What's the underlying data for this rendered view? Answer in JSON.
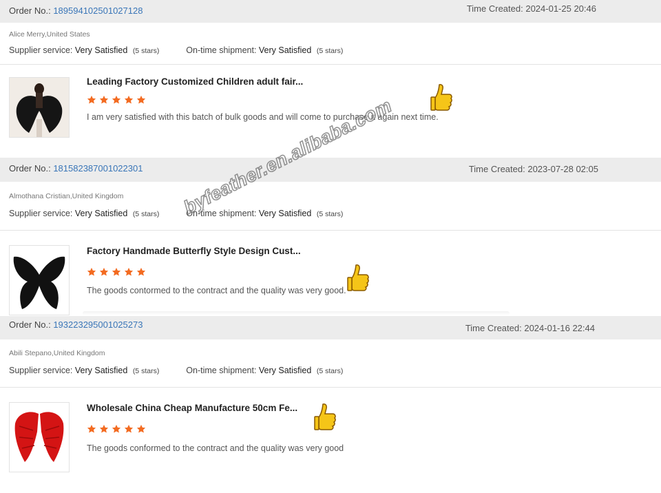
{
  "labels": {
    "order_no": "Order No.:",
    "time_created": "Time Created:",
    "supplier_service": "Supplier service:",
    "ontime_shipment": "On-time shipment:"
  },
  "reviews": [
    {
      "order_no": "189594102501027128",
      "time_created": "2024-01-25 20:46",
      "buyer": "Alice Merry,United States",
      "supplier_rating": "Very Satisfied",
      "supplier_stars": "(5 stars)",
      "shipment_rating": "Very Satisfied",
      "shipment_stars": "(5 stars)",
      "product_title": "Leading Factory Customized Children adult fair...",
      "rating": 5,
      "comment": "I am very satisfied with this batch of bulk goods and will come to purchase it again next time.",
      "thumb_icon": "black-feather-wings-on-person-photo"
    },
    {
      "order_no": "181582387001022301",
      "time_created": "2023-07-28 02:05",
      "buyer": "Almothana Cristian,United Kingdom",
      "supplier_rating": "Very Satisfied",
      "supplier_stars": "(5 stars)",
      "shipment_rating": "Very Satisfied",
      "shipment_stars": "(5 stars)",
      "product_title": "Factory Handmade Butterfly Style Design Cust...",
      "rating": 5,
      "comment": "The goods contormed to the contract and  the quality was very good.",
      "thumb_icon": "black-butterfly-wings-photo"
    },
    {
      "order_no": "193223295001025273",
      "time_created": "2024-01-16 22:44",
      "buyer": "Abili Stepano,United Kingdom",
      "supplier_rating": "Very Satisfied",
      "supplier_stars": "(5 stars)",
      "shipment_rating": "Very Satisfied",
      "shipment_stars": "(5 stars)",
      "product_title": "Wholesale China Cheap Manufacture 50cm Fe...",
      "rating": 5,
      "comment": "The goods conformed to the contract and the quality was very good",
      "thumb_icon": "red-feather-wings-photo"
    }
  ],
  "watermark": "byfeather.en.alibaba.com",
  "colors": {
    "order_number": "#3a76b8",
    "star": "#f36b21",
    "order_bar": "#ececec",
    "thumbs_up": "#f5c518"
  }
}
